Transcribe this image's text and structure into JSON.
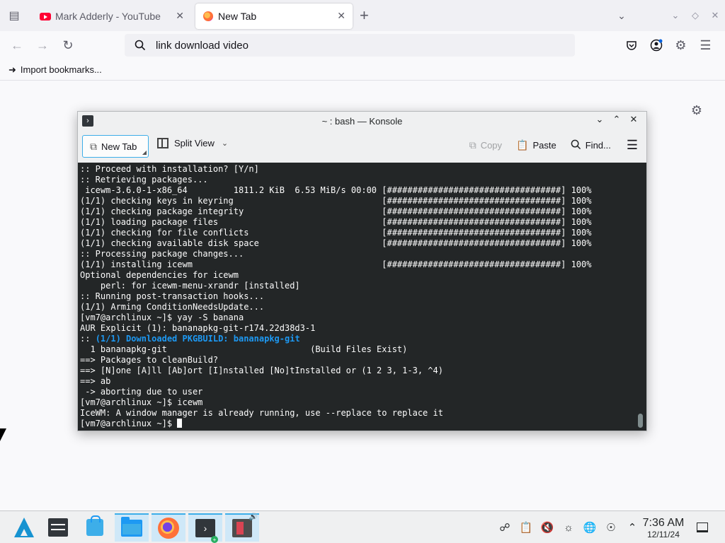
{
  "browser": {
    "tabs": [
      {
        "title": "Mark Adderly - YouTube",
        "active": false
      },
      {
        "title": "New Tab",
        "active": true
      }
    ],
    "url_text": "link download video",
    "bookmark_item": "Import bookmarks..."
  },
  "konsole": {
    "title": "~ : bash — Konsole",
    "toolbar": {
      "new_tab": "New Tab",
      "split_view": "Split View",
      "copy": "Copy",
      "paste": "Paste",
      "find": "Find..."
    },
    "lines": [
      ":: Proceed with installation? [Y/n]",
      ":: Retrieving packages...",
      " icewm-3.6.0-1-x86_64         1811.2 KiB  6.53 MiB/s 00:00 [##################################] 100%",
      "(1/1) checking keys in keyring                             [##################################] 100%",
      "(1/1) checking package integrity                           [##################################] 100%",
      "(1/1) loading package files                                [##################################] 100%",
      "(1/1) checking for file conflicts                          [##################################] 100%",
      "(1/1) checking available disk space                        [##################################] 100%",
      ":: Processing package changes...",
      "(1/1) installing icewm                                     [##################################] 100%",
      "Optional dependencies for icewm",
      "    perl: for icewm-menu-xrandr [installed]",
      ":: Running post-transaction hooks...",
      "(1/1) Arming ConditionNeedsUpdate...",
      "[vm7@archlinux ~]$ yay -S banana",
      "AUR Explicit (1): bananapkg-git-r174.22d38d3-1",
      "__HL__",
      "  1 bananapkg-git                            (Build Files Exist)",
      "==> Packages to cleanBuild?",
      "==> [N]one [A]ll [Ab]ort [I]nstalled [No]tInstalled or (1 2 3, 1-3, ^4)",
      "==> ab",
      " -> aborting due to user",
      "[vm7@archlinux ~]$ icewm",
      "IceWM: A window manager is already running, use --replace to replace it"
    ],
    "highlight_prefix": ":: ",
    "highlight_text": "(1/1) Downloaded PKGBUILD: bananapkg-git",
    "prompt": "[vm7@archlinux ~]$ "
  },
  "taskbar": {
    "time": "7:36 AM",
    "date": "12/11/24"
  }
}
